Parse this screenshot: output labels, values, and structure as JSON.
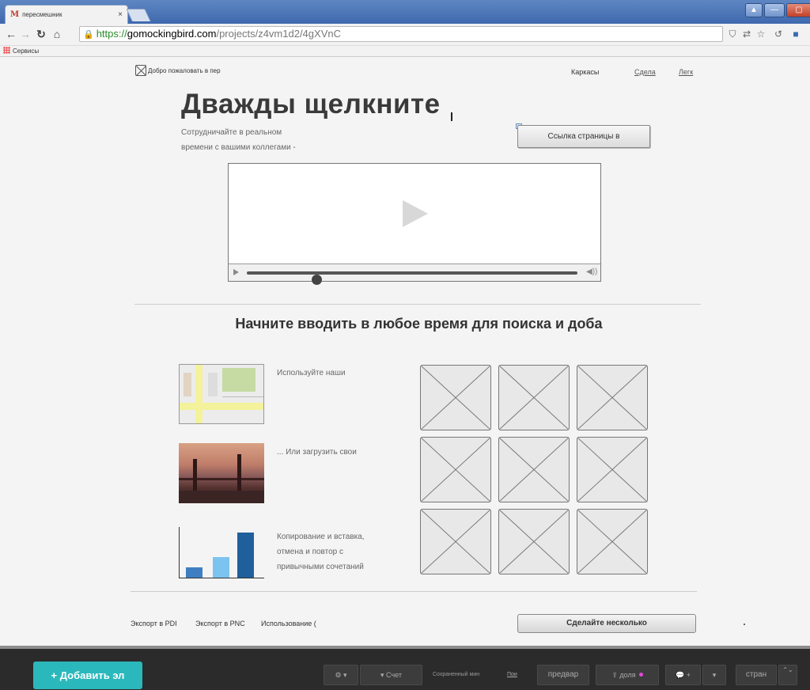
{
  "browser": {
    "tab_title": "пересмешник",
    "tab_favicon": "M",
    "tab_close": "×",
    "url_scheme": "https://",
    "url_host": "gomockingbird.com",
    "url_path": "/projects/z4vm1d2/4gXVnC",
    "bookmarks_label": "Сервисы"
  },
  "page": {
    "welcome_text": "Добро пожаловать в пер",
    "nav": [
      "Каркасы",
      "Сдела",
      "Легк"
    ],
    "headline": "Дважды щелкните",
    "subtext_line1": "Сотрудничайте в реальном",
    "subtext_line2": "времени с вашими коллегами -",
    "link_button": "Ссылка страницы в",
    "video_progress": 0.21,
    "section_title": "Начните вводить в любое время для поиска и доба",
    "features": [
      {
        "text": "Используйте наши"
      },
      {
        "text": "... Или загрузить свои"
      },
      {
        "lines": [
          "Копирование и вставка,",
          "отмена и повтор с",
          "привычными сочетаний"
        ]
      }
    ],
    "chart_thumb_bars": [
      {
        "value": 0.22,
        "color": "#3f7fc1"
      },
      {
        "value": 0.45,
        "color": "#7cc3f0"
      },
      {
        "value": 1.0,
        "color": "#1f5f9c"
      }
    ],
    "bottom_links": [
      "Экспорт в PDI",
      "Экспорт в PNC",
      "Использование ("
    ],
    "many_button": "Сделайте несколько"
  },
  "appbar": {
    "add_button": "+ Добавить эл",
    "settings": "⚙ ▾",
    "account": "▾ Счет",
    "saved_text": "Сохраненный мин",
    "saved_link": "Пои",
    "preview": "предвар",
    "share": "⇪ доля",
    "comments": "💬 +",
    "comments_dropdown": "▾",
    "page": "стран",
    "page_stepper": "⌃⌄"
  },
  "colors": {
    "accent": "#2bb8bc",
    "appbar_bg": "#2b2b2b",
    "titlebar": "#4a74b6"
  }
}
